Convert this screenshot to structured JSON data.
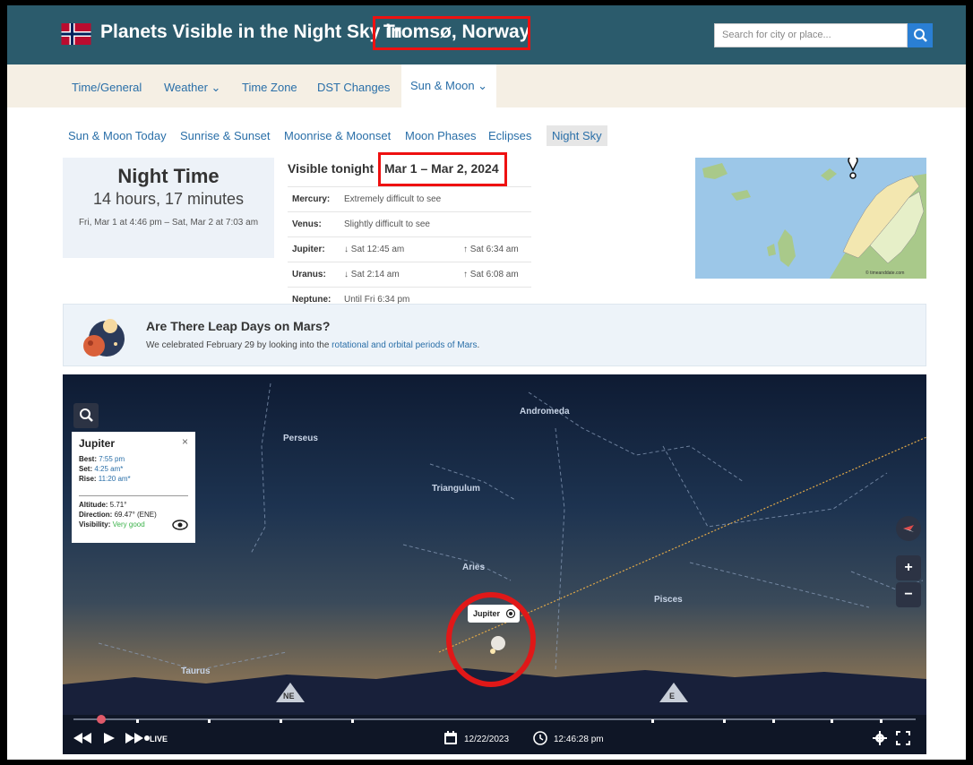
{
  "header": {
    "title": "Planets Visible in the Night Sky in",
    "place": "Tromsø, Norway",
    "search_placeholder": "Search for city or place..."
  },
  "nav": {
    "items": [
      {
        "label": "Time/General"
      },
      {
        "label": "Weather ⌄"
      },
      {
        "label": "Time Zone"
      },
      {
        "label": "DST Changes"
      },
      {
        "label": "Sun & Moon ⌄",
        "active": true
      }
    ]
  },
  "subnav": {
    "items": [
      {
        "label": "Sun & Moon Today"
      },
      {
        "label": "Sunrise & Sunset"
      },
      {
        "label": "Moonrise & Moonset"
      },
      {
        "label": "Moon Phases"
      },
      {
        "label": "Eclipses"
      },
      {
        "label": "Night Sky",
        "selected": true
      }
    ]
  },
  "night": {
    "title": "Night Time",
    "duration": "14 hours, 17 minutes",
    "range": "Fri, Mar 1 at 4:46 pm – Sat, Mar 2 at 7:03 am"
  },
  "visible": {
    "heading": "Visible tonight",
    "dates": "Mar 1 – Mar 2, 2024",
    "planets": [
      {
        "name": "Mercury:",
        "desc": "Extremely difficult to see",
        "rise": ""
      },
      {
        "name": "Venus:",
        "desc": "Slightly difficult to see",
        "rise": ""
      },
      {
        "name": "Jupiter:",
        "desc": "↓ Sat 12:45 am",
        "rise": "↑ Sat 6:34 am"
      },
      {
        "name": "Uranus:",
        "desc": "↓ Sat 2:14 am",
        "rise": "↑ Sat 6:08 am"
      },
      {
        "name": "Neptune:",
        "desc": "Until Fri 6:34 pm",
        "rise": ""
      }
    ]
  },
  "map": {
    "credit": "© timeanddate.com"
  },
  "banner": {
    "title": "Are There Leap Days on Mars?",
    "text": "We celebrated February 29 by looking into the ",
    "link": "rotational and orbital periods of Mars",
    "tail": "."
  },
  "sky": {
    "constellations": [
      "Andromeda",
      "Perseus",
      "Triangulum",
      "Aries",
      "Pisces",
      "Taurus"
    ],
    "panel": {
      "title": "Jupiter",
      "close": "×",
      "best_label": "Best:",
      "best": "7:55 pm",
      "set_label": "Set:",
      "set": "4:25 am*",
      "rise_label": "Rise:",
      "rise": "11:20 am*",
      "altitude_label": "Altitude:",
      "altitude": "5.71°",
      "direction_label": "Direction:",
      "direction": "69.47° (ENE)",
      "visibility_label": "Visibility:",
      "visibility": "Very good"
    },
    "planet_label": "Jupiter",
    "directions": [
      "NE",
      "E"
    ],
    "zoom_in": "+",
    "zoom_out": "−",
    "live": "LIVE",
    "date": "12/22/2023",
    "time": "12:46:28 pm"
  }
}
